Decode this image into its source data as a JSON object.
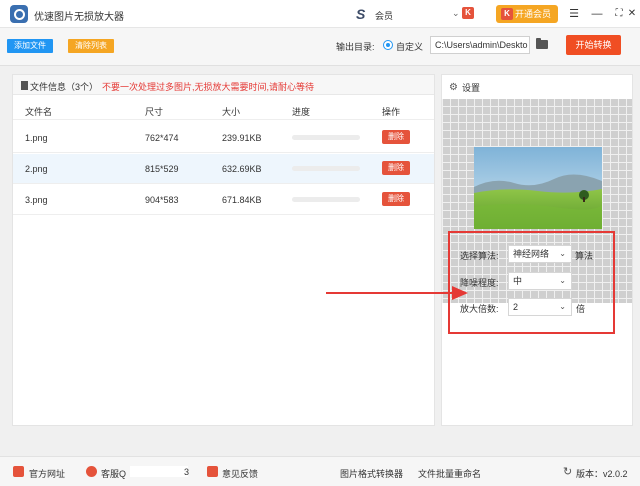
{
  "titlebar": {
    "title": "优速图片无损放大器",
    "user_logo": "S",
    "user_name": "会员",
    "user_caret": "⌄",
    "user_badge": "K",
    "vip_icon": "K",
    "vip_label": "开通会员",
    "menu_glyph": "☰",
    "minimize_glyph": "—",
    "maximize_glyph": "⛶",
    "close_glyph": "✕"
  },
  "toolbar": {
    "add_label": "添加文件",
    "clear_label": "清除列表",
    "output_label": "输出目录:",
    "custom_label": "自定义",
    "output_path": "C:\\Users\\admin\\Deskto",
    "start_label": "开始转换"
  },
  "file_panel": {
    "title": "文件信息（3个）",
    "warning": "不要一次处理过多图片,无损放大需要时间,请耐心等待",
    "columns": {
      "name": "文件名",
      "dims": "尺寸",
      "size": "大小",
      "progress": "进度",
      "action": "操作"
    },
    "delete_label": "删除",
    "rows": [
      {
        "name": "1.png",
        "dims": "762*474",
        "size": "239.91KB",
        "progress": 0
      },
      {
        "name": "2.png",
        "dims": "815*529",
        "size": "632.69KB",
        "progress": 0
      },
      {
        "name": "3.png",
        "dims": "904*583",
        "size": "671.84KB",
        "progress": 0
      }
    ]
  },
  "settings": {
    "title": "设置",
    "algorithm_label": "选择算法:",
    "algorithm_value": "神经网络",
    "algorithm_suffix": "算法",
    "denoise_label": "降噪程度:",
    "denoise_value": "中",
    "scale_label": "放大倍数:",
    "scale_value": "2",
    "scale_suffix": "倍",
    "caret": "⌄"
  },
  "footer": {
    "website": "官方网址",
    "support": "客服Q",
    "support_tail": "3",
    "feedback": "意见反馈",
    "format_convert": "图片格式转换器",
    "batch_rename": "文件批量重命名",
    "version_label": "版本：v2.0.2"
  },
  "colors": {
    "accent_blue": "#2196f3",
    "accent_orange": "#f5a623",
    "accent_red": "#f04e23",
    "highlight_red": "#e53935"
  }
}
